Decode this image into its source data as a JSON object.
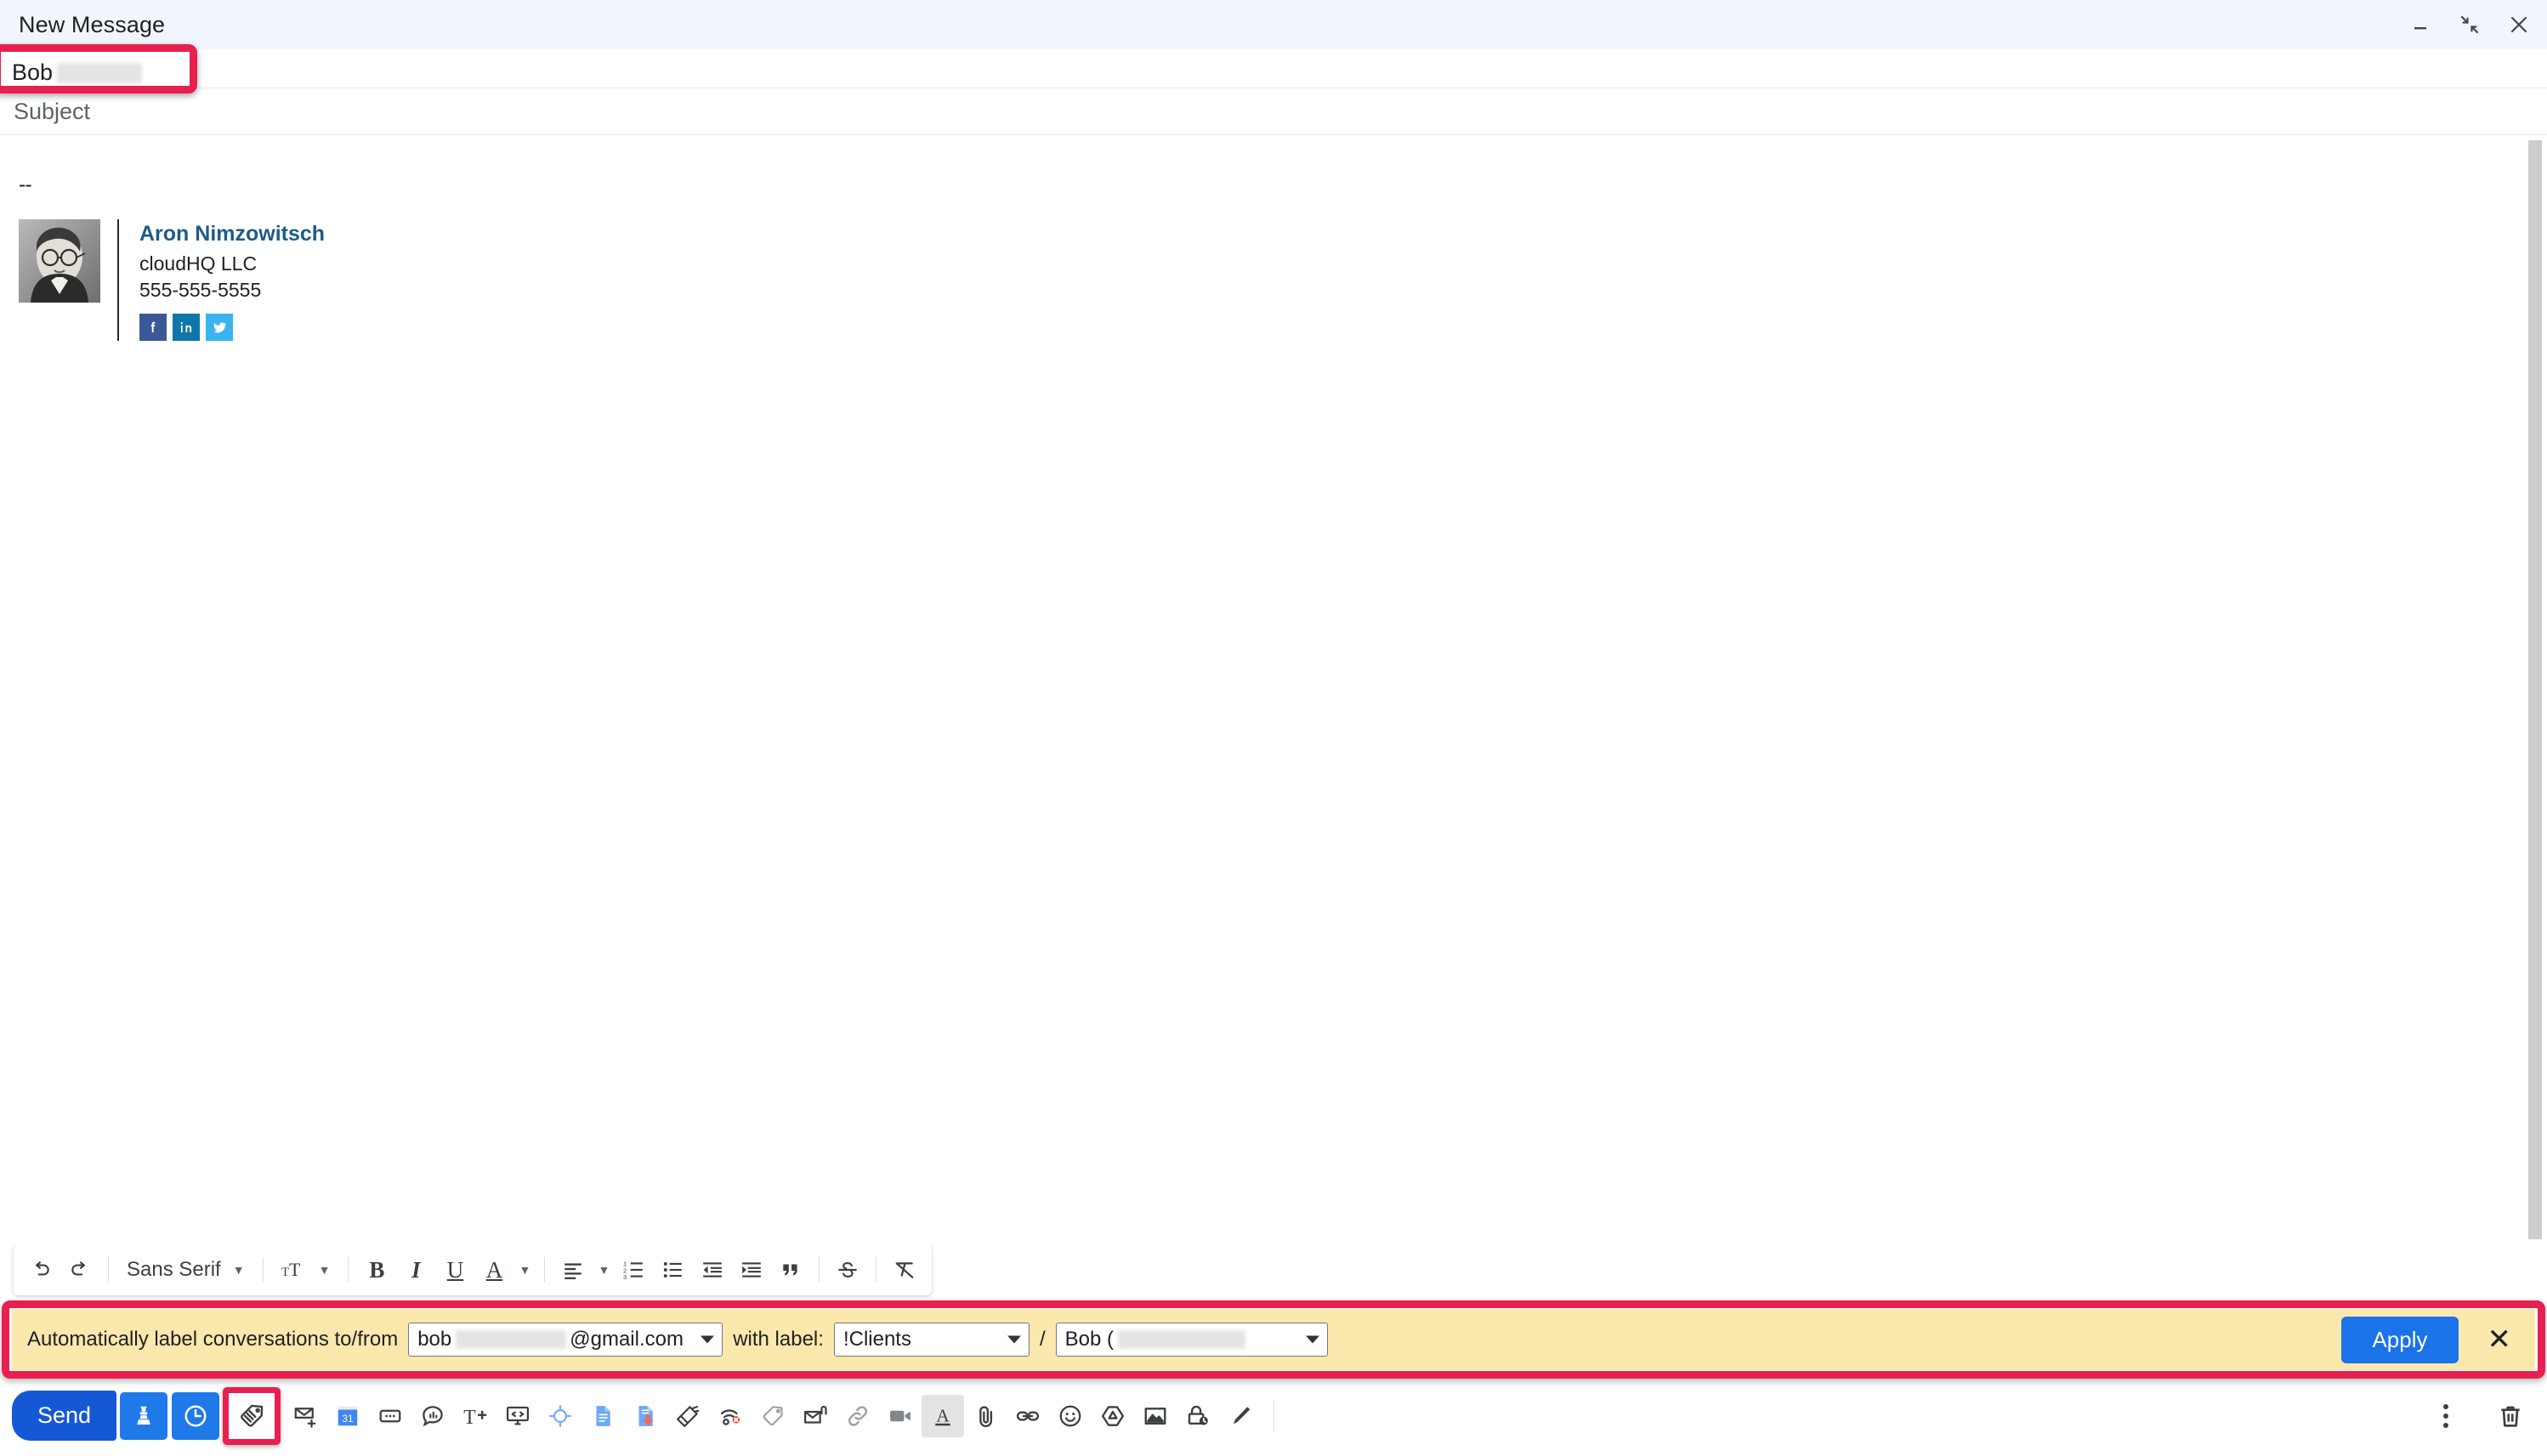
{
  "header": {
    "title": "New Message",
    "controls": [
      {
        "name": "minimize",
        "label": "Minimize"
      },
      {
        "name": "exit-full-screen",
        "label": "Exit full screen"
      },
      {
        "name": "close",
        "label": "Close"
      }
    ]
  },
  "recipient": {
    "value": "Bob",
    "redacted": true
  },
  "subject": {
    "placeholder": "Subject",
    "value": ""
  },
  "body": {
    "signature_separator": "--",
    "signature": {
      "name": "Aron Nimzowitsch",
      "company": "cloudHQ LLC",
      "phone": "555-555-5555",
      "social": [
        {
          "name": "facebook-icon",
          "glyph": "f",
          "color": "#3b5998"
        },
        {
          "name": "linkedin-icon",
          "glyph": "in",
          "color": "#0e76a8"
        },
        {
          "name": "twitter-icon",
          "glyph": "bird",
          "color": "#38b4ee"
        }
      ]
    }
  },
  "format_toolbar": {
    "undo": "undo-icon",
    "redo": "redo-icon",
    "font_family": "Sans Serif",
    "font_size": "font-size-icon",
    "bold": "B",
    "italic": "I",
    "underline": "U",
    "text_color": "A",
    "align": "align-left-icon",
    "numbered_list": "numbered-list-icon",
    "bulleted_list": "bulleted-list-icon",
    "indent_less": "indent-less-icon",
    "indent_more": "indent-more-icon",
    "quote": "quote-icon",
    "strikethrough": "strikethrough-icon",
    "remove_formatting": "remove-formatting-icon"
  },
  "banner": {
    "text_prefix": "Automatically label conversations to/from",
    "email_select": {
      "prefix": "bob",
      "suffix": "@gmail.com"
    },
    "text_middle": "with label:",
    "label_select": "!Clients",
    "separator": "/",
    "sublabel_select": "Bob (",
    "apply_label": "Apply",
    "close_label": "✕"
  },
  "bottom_bar": {
    "send_label": "Send",
    "buttons": [
      {
        "name": "chess-piece-icon",
        "label": "Send later (chess)"
      },
      {
        "name": "clock-icon",
        "label": "Schedule send"
      },
      {
        "name": "label-tag-icon",
        "label": "Auto label",
        "highlighted": true
      },
      {
        "name": "email-plus-icon",
        "label": "Email templates"
      },
      {
        "name": "calendar-31-icon",
        "label": "Calendar"
      },
      {
        "name": "dots-box-icon",
        "label": "Canned responses"
      },
      {
        "name": "chat-chart-icon",
        "label": "Poll"
      },
      {
        "name": "text-plus-icon",
        "label": "Insert signature"
      },
      {
        "name": "code-monitor-icon",
        "label": "HTML editor"
      },
      {
        "name": "crosshair-icon",
        "label": "Tracking target"
      },
      {
        "name": "google-doc-icon",
        "label": "Google Docs"
      },
      {
        "name": "doc-download-icon",
        "label": "Save as document"
      },
      {
        "name": "sweep-icon",
        "label": "Sweep"
      },
      {
        "name": "wifi-off-icon",
        "label": "Disable tracking"
      },
      {
        "name": "tag-icon",
        "label": "Tag"
      },
      {
        "name": "mail-attach-icon",
        "label": "Attach email"
      },
      {
        "name": "link-chain-icon",
        "label": "Insert link"
      },
      {
        "name": "video-icon",
        "label": "Video"
      },
      {
        "name": "format-text-icon",
        "label": "Formatting options",
        "active": true
      },
      {
        "name": "paperclip-icon",
        "label": "Attach files"
      },
      {
        "name": "link-icon",
        "label": "Insert link"
      },
      {
        "name": "emoji-icon",
        "label": "Insert emoji"
      },
      {
        "name": "drive-icon",
        "label": "Insert files using Drive"
      },
      {
        "name": "image-icon",
        "label": "Insert photo"
      },
      {
        "name": "confidential-icon",
        "label": "Confidential mode"
      },
      {
        "name": "pen-icon",
        "label": "Signature"
      }
    ],
    "more_options": "more-options-icon",
    "discard": "trash-icon"
  },
  "colors": {
    "highlight": "#e8204f",
    "banner_bg": "#fbe8ac",
    "apply_blue": "#1a73e8",
    "send_blue": "#1558d6",
    "header_bg": "#f2f6fc"
  }
}
